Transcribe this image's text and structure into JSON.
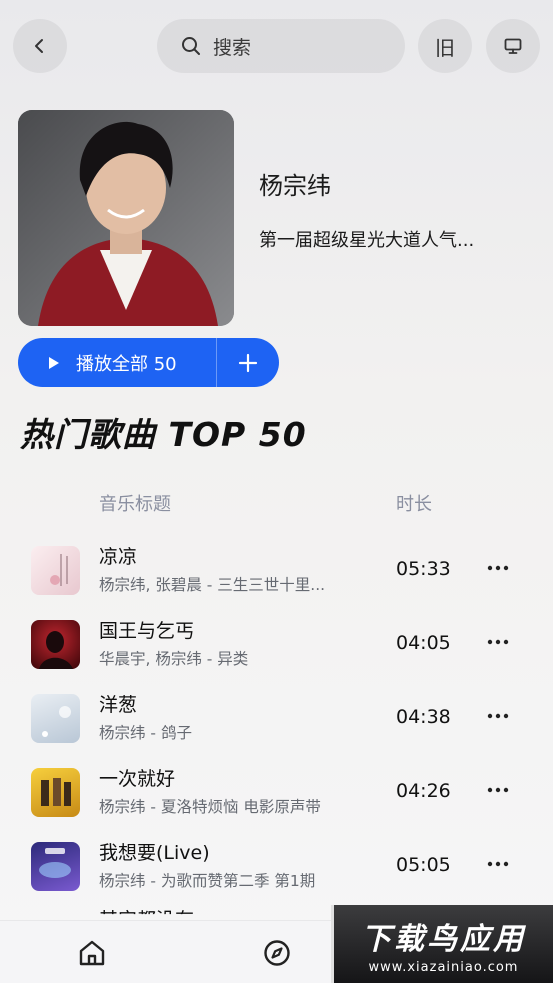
{
  "header": {
    "search_placeholder": "搜索",
    "old_label": "旧",
    "icons": {
      "back": "chevron-left-icon",
      "search": "search-icon",
      "screen": "monitor-icon"
    }
  },
  "artist": {
    "name": "杨宗纬",
    "description": "第一届超级星光大道人气..."
  },
  "play_all": {
    "label": "播放全部 50"
  },
  "section": {
    "title": "热门歌曲 TOP 50"
  },
  "columns": {
    "title": "音乐标题",
    "duration": "时长"
  },
  "songs": [
    {
      "title": "凉凉",
      "subtitle": "杨宗纬, 张碧晨 - 三生三世十里...",
      "duration": "05:33",
      "cover_color": "#f1dfe2"
    },
    {
      "title": "国王与乞丐",
      "subtitle": "华晨宇, 杨宗纬 - 异类",
      "duration": "04:05",
      "cover_color": "#7b1016"
    },
    {
      "title": "洋葱",
      "subtitle": "杨宗纬 - 鸽子",
      "duration": "04:38",
      "cover_color": "#cfd8e2"
    },
    {
      "title": "一次就好",
      "subtitle": "杨宗纬 - 夏洛特烦恼 电影原声带",
      "duration": "04:26",
      "cover_color": "#e6b52a"
    },
    {
      "title": "我想要(Live)",
      "subtitle": "杨宗纬 - 为歌而赞第二季 第1期",
      "duration": "05:05",
      "cover_color": "#4a3a9a"
    }
  ],
  "peek_song": {
    "title": "其实都没有"
  },
  "watermark": {
    "main": "下载鸟应用",
    "url": "www.xiazainiao.com"
  },
  "accent": "#1e63f3"
}
